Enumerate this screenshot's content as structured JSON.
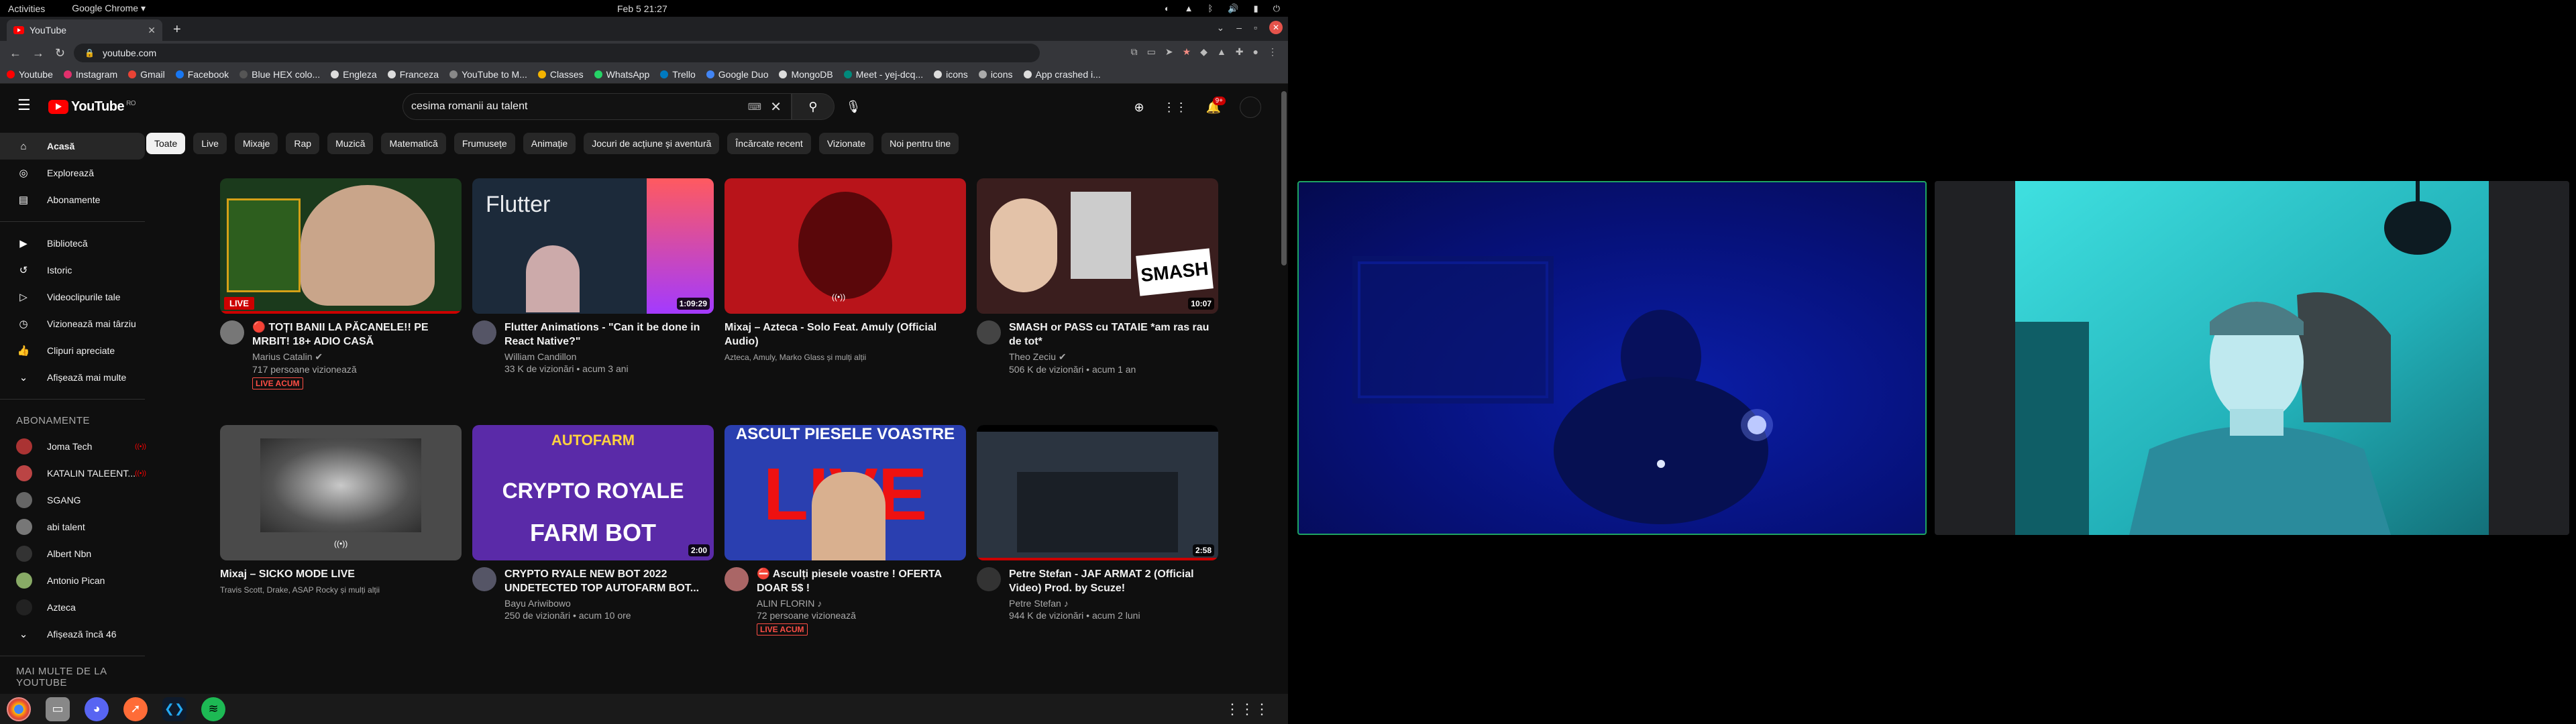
{
  "system": {
    "activities": "Activities",
    "app_menu": "Google Chrome ▾",
    "clock": "Feb 5  21:27"
  },
  "browser": {
    "tab_title": "YouTube",
    "url": "youtube.com",
    "bookmarks": [
      {
        "label": "Youtube",
        "color": "#ff0000"
      },
      {
        "label": "Instagram",
        "color": "#e1306c"
      },
      {
        "label": "Gmail",
        "color": "#ea4335"
      },
      {
        "label": "Facebook",
        "color": "#1877f2"
      },
      {
        "label": "Blue HEX colo...",
        "color": "#555555"
      },
      {
        "label": "Engleza",
        "color": "#dddddd"
      },
      {
        "label": "Franceza",
        "color": "#dddddd"
      },
      {
        "label": "YouTube to M...",
        "color": "#888888"
      },
      {
        "label": "Classes",
        "color": "#f4b400"
      },
      {
        "label": "WhatsApp",
        "color": "#25d366"
      },
      {
        "label": "Trello",
        "color": "#0079bf"
      },
      {
        "label": "Google Duo",
        "color": "#4285f4"
      },
      {
        "label": "MongoDB",
        "color": "#dddddd"
      },
      {
        "label": "Meet - yej-dcq...",
        "color": "#00897b"
      },
      {
        "label": "icons",
        "color": "#dddddd"
      },
      {
        "label": "icons",
        "color": "#aaaaaa"
      },
      {
        "label": "App crashed i...",
        "color": "#dddddd"
      }
    ]
  },
  "youtube": {
    "logo_text": "YouTube",
    "logo_region": "RO",
    "search_query": "cesima romanii au talent",
    "notification_count": "9+",
    "sidebar": {
      "main": [
        {
          "label": "Acasă",
          "icon": "home-icon"
        },
        {
          "label": "Explorează",
          "icon": "explore-icon"
        },
        {
          "label": "Abonamente",
          "icon": "subscriptions-icon"
        }
      ],
      "library": [
        {
          "label": "Bibliotecă",
          "icon": "library-icon"
        },
        {
          "label": "Istoric",
          "icon": "history-icon"
        },
        {
          "label": "Videoclipurile tale",
          "icon": "your-videos-icon"
        },
        {
          "label": "Vizionează mai târziu",
          "icon": "watch-later-icon"
        },
        {
          "label": "Clipuri apreciate",
          "icon": "liked-icon"
        },
        {
          "label": "Afișează mai multe",
          "icon": "chevron-down-icon"
        }
      ],
      "subs_heading": "ABONAMENTE",
      "subs": [
        {
          "label": "Joma Tech",
          "color": "#a33",
          "live": true
        },
        {
          "label": "KATALIN TALEENT...",
          "color": "#b44",
          "live": true
        },
        {
          "label": "SGANG",
          "color": "#666",
          "live": false
        },
        {
          "label": "abi talent",
          "color": "#777",
          "live": false
        },
        {
          "label": "Albert Nbn",
          "color": "#333",
          "live": false
        },
        {
          "label": "Antonio Pican",
          "color": "#8a6",
          "live": false
        },
        {
          "label": "Azteca",
          "color": "#222",
          "live": false
        }
      ],
      "show_more_subs": "Afișează încă 46",
      "more_heading": "MAI MULTE DE LA YOUTUBE"
    },
    "chips": [
      "Toate",
      "Live",
      "Mixaje",
      "Rap",
      "Muzică",
      "Matematică",
      "Frumusețe",
      "Animație",
      "Jocuri de acțiune și aventură",
      "Încărcate recent",
      "Vizionate",
      "Noi pentru tine"
    ],
    "videos": [
      {
        "title": "🔴 TOȚI BANII LA PĂCANELE!! PE MRBIT! 18+ ADIO CASĂ",
        "channel": "Marius Catalin ✔",
        "stats": "717 persoane vizionează",
        "badge": "LIVE ACUM",
        "thumb_badge": "LIVE",
        "duration": "",
        "bg": "#1b3a1c",
        "av": "#777"
      },
      {
        "title": "Flutter Animations - \"Can it be done in React Native?\"",
        "channel": "William Candillon",
        "stats": "33 K de vizionări • acum 3 ani",
        "badge": "",
        "thumb_badge": "",
        "duration": "1:09:29",
        "bg": "#1c2a3a",
        "av": "#556"
      },
      {
        "title": "Mixaj – Azteca - Solo Feat. Amuly (Official Audio)",
        "channel": "",
        "stats": "",
        "sub": "Azteca, Amuly, Marko Glass și mulți alții",
        "badge": "",
        "thumb_badge": "",
        "duration": "",
        "bg": "#b8141a",
        "av": ""
      },
      {
        "title": "SMASH or PASS cu TATAIE *am ras rau de tot*",
        "channel": "Theo Zeciu ✔",
        "stats": "506 K de vizionări • acum 1 an",
        "badge": "",
        "thumb_badge": "",
        "duration": "10:07",
        "bg": "#3a1e1e",
        "av": "#444"
      },
      {
        "title": "Mixaj – SICKO MODE LIVE",
        "channel": "",
        "stats": "",
        "sub": "Travis Scott, Drake, ASAP Rocky și mulți alții",
        "badge": "",
        "thumb_badge": "",
        "duration": "",
        "bg": "#4a4a4a",
        "av": ""
      },
      {
        "title": "CRYPTO RYALE NEW BOT 2022 UNDETECTED TOP AUTOFARM BOT...",
        "channel": "Bayu Ariwibowo",
        "stats": "250 de vizionări • acum 10 ore",
        "badge": "",
        "thumb_badge": "",
        "duration": "2:00",
        "bg": "#5a2aa8",
        "av": "#556"
      },
      {
        "title": "⛔ Asculți piesele voastre ! OFERTA DOAR 5$ !",
        "channel": "ALIN FLORIN ♪",
        "stats": "72 persoane vizionează",
        "badge": "LIVE ACUM",
        "thumb_badge": "",
        "duration": "",
        "bg": "#2a3fb0",
        "av": "#a66"
      },
      {
        "title": "Petre Stefan - JAF ARMAT 2 (Official Video) Prod. by Scuze!",
        "channel": "Petre Stefan ♪",
        "stats": "944 K de vizionări • acum 2 luni",
        "badge": "",
        "thumb_badge": "",
        "duration": "2:58",
        "bg": "#2b3440",
        "av": "#333"
      }
    ],
    "thumb_texts": {
      "flutter": "Flutter",
      "smash": "SMASH",
      "autofarm": "AUTOFARM",
      "crypto": "CRYPTO ROYALE",
      "farmbot": "FARM BOT",
      "asculti": "ASCULT PIESELE VOASTRE",
      "live_big": "LIVE"
    }
  }
}
